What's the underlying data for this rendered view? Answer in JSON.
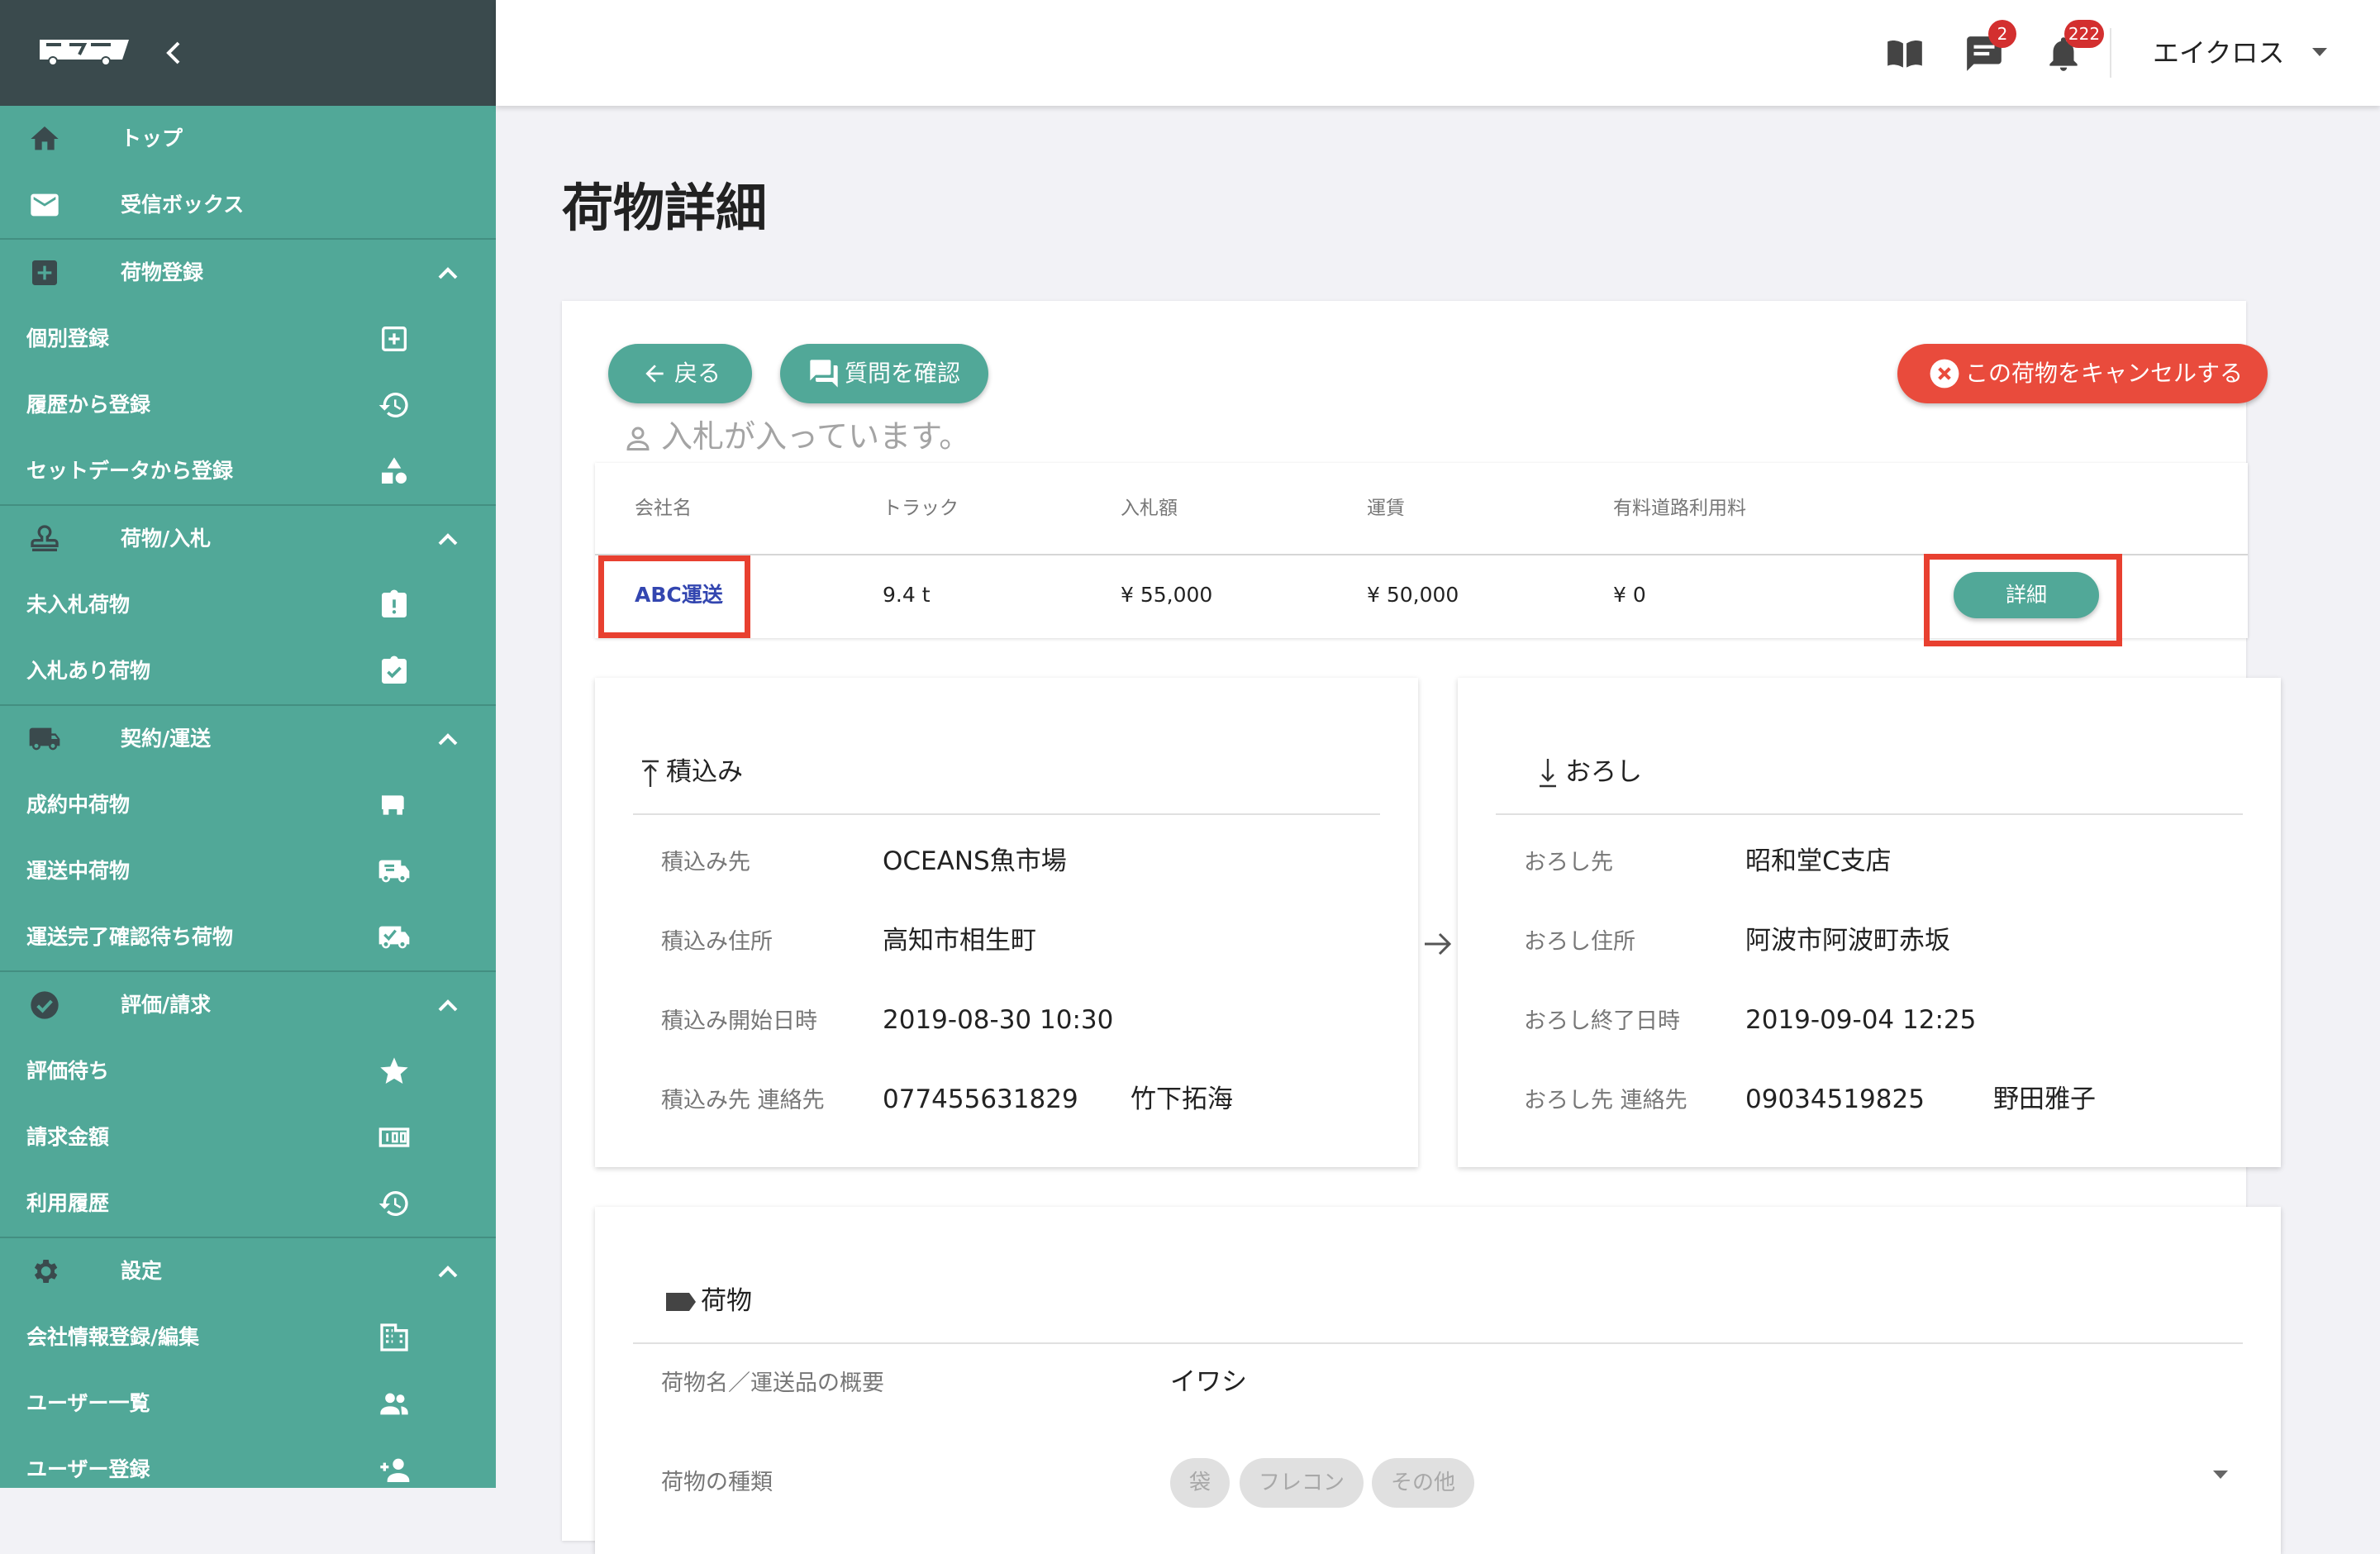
{
  "sidebar": {
    "items": [
      {
        "label": "トップ",
        "icon": "home-icon"
      },
      {
        "label": "受信ボックス",
        "icon": "mail-icon"
      },
      {
        "label": "荷物登録",
        "icon": "add-box-icon"
      },
      {
        "label": "個別登録",
        "icon": "plus-square-icon"
      },
      {
        "label": "履歴から登録",
        "icon": "history-icon"
      },
      {
        "label": "セットデータから登録",
        "icon": "shapes-icon"
      },
      {
        "label": "荷物/入札",
        "icon": "stamp-icon"
      },
      {
        "label": "未入札荷物",
        "icon": "clipboard-alert-icon"
      },
      {
        "label": "入札あり荷物",
        "icon": "clipboard-check-icon"
      },
      {
        "label": "契約/運送",
        "icon": "truck-icon"
      },
      {
        "label": "成約中荷物",
        "icon": "truck-icon"
      },
      {
        "label": "運送中荷物",
        "icon": "truck-fast-icon"
      },
      {
        "label": "運送完了確認待ち荷物",
        "icon": "truck-check-icon"
      },
      {
        "label": "評価/請求",
        "icon": "check-circle-icon"
      },
      {
        "label": "評価待ち",
        "icon": "star-icon"
      },
      {
        "label": "請求金額",
        "icon": "counter-icon"
      },
      {
        "label": "利用履歴",
        "icon": "history-icon"
      },
      {
        "label": "設定",
        "icon": "gear-icon"
      },
      {
        "label": "会社情報登録/編集",
        "icon": "building-icon"
      },
      {
        "label": "ユーザー一覧",
        "icon": "users-icon"
      },
      {
        "label": "ユーザー登録",
        "icon": "add-user-icon"
      }
    ]
  },
  "topbar": {
    "message_count": "2",
    "notification_count": "222",
    "user_name": "エイクロス"
  },
  "page": {
    "title": "荷物詳細",
    "back_label": "戻る",
    "questions_label": "質問を確認",
    "cancel_label": "この荷物をキャンセルする",
    "bid_notice": "入札が入っています。"
  },
  "bids": {
    "headers": [
      "会社名",
      "トラック",
      "入札額",
      "運賃",
      "有料道路利用料"
    ],
    "rows": [
      {
        "company": "ABC運送",
        "truck": "9.4 t",
        "bid": "¥ 55,000",
        "fare": "¥ 50,000",
        "toll": "¥ 0",
        "detail_label": "詳細"
      }
    ]
  },
  "loading": {
    "title": "積込み",
    "place_label": "積込み先",
    "place": "OCEANS魚市場",
    "address_label": "積込み住所",
    "address": "高知市相生町",
    "start_label": "積込み開始日時",
    "start": "2019-08-30 10:30",
    "contact_label": "積込み先 連絡先",
    "phone": "077455631829",
    "person": "竹下拓海"
  },
  "unloading": {
    "title": "おろし",
    "place_label": "おろし先",
    "place": "昭和堂C支店",
    "address_label": "おろし住所",
    "address": "阿波市阿波町赤坂",
    "end_label": "おろし終了日時",
    "end": "2019-09-04 12:25",
    "contact_label": "おろし先 連絡先",
    "phone": "09034519825",
    "person": "野田雅子"
  },
  "cargo": {
    "title": "荷物",
    "name_label": "荷物名／運送品の概要",
    "name": "イワシ",
    "type_label": "荷物の種類",
    "type_options": [
      "袋",
      "フレコン",
      "その他"
    ]
  },
  "colors": {
    "sidebar": "#51a898",
    "sidebar_header": "#3a4a4d",
    "accent": "#51a898",
    "danger": "#e94b3c",
    "badge": "#d32f2f",
    "link": "#3346b0",
    "highlight": "#e84030"
  }
}
